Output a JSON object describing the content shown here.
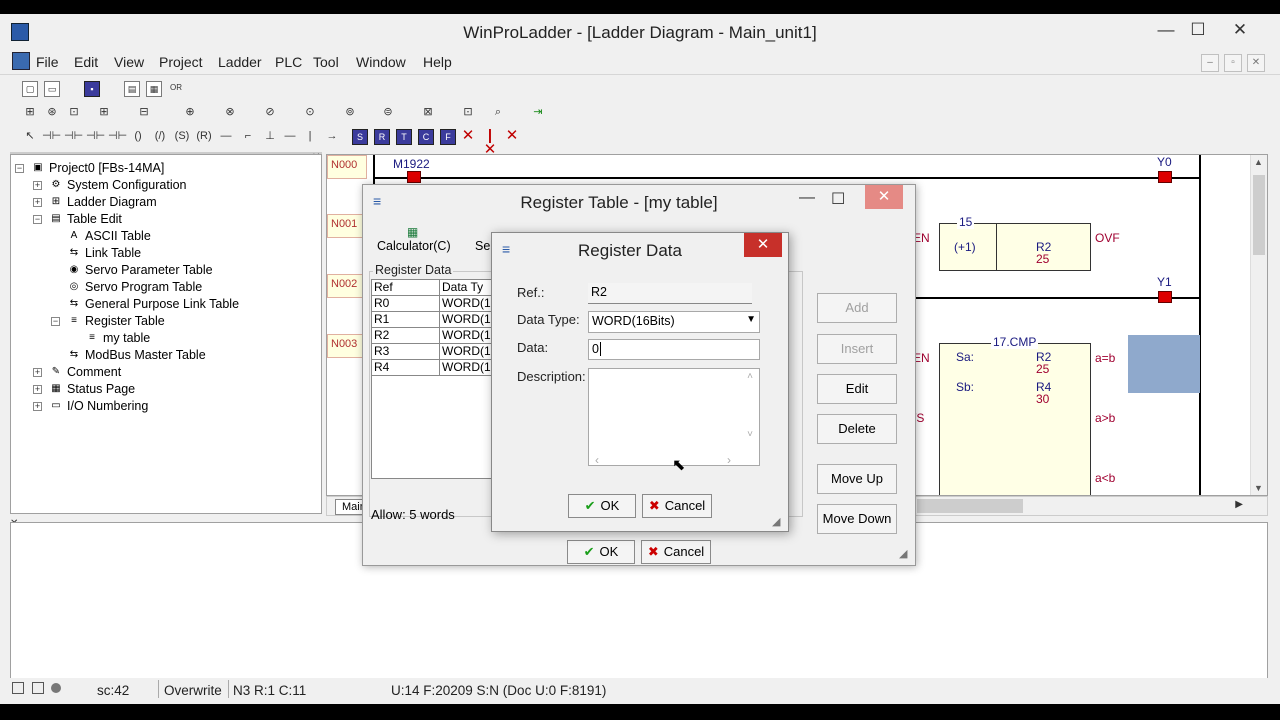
{
  "window": {
    "title": "WinProLadder - [Ladder Diagram - Main_unit1]",
    "min": "—",
    "max": "☐",
    "close": "✕"
  },
  "menu": [
    "File",
    "Edit",
    "View",
    "Project",
    "Ladder",
    "PLC",
    "Tool",
    "Window",
    "Help"
  ],
  "tree": {
    "items": [
      {
        "label": "Project0 [FBs-14MA]",
        "exp": "−",
        "icon": "▣"
      },
      {
        "label": "System Configuration",
        "exp": "+",
        "icon": "⚙"
      },
      {
        "label": "Ladder Diagram",
        "exp": "+",
        "icon": "⊞"
      },
      {
        "label": "Table Edit",
        "exp": "−",
        "icon": "▤"
      },
      {
        "label": "ASCII Table",
        "exp": "",
        "icon": "A"
      },
      {
        "label": "Link Table",
        "exp": "",
        "icon": "⇆"
      },
      {
        "label": "Servo Parameter Table",
        "exp": "",
        "icon": "◉"
      },
      {
        "label": "Servo Program Table",
        "exp": "",
        "icon": "◎"
      },
      {
        "label": "General Purpose Link Table",
        "exp": "",
        "icon": "⇆"
      },
      {
        "label": "Register Table",
        "exp": "−",
        "icon": "≡"
      },
      {
        "label": "my table",
        "exp": "",
        "icon": "≡"
      },
      {
        "label": "ModBus Master Table",
        "exp": "",
        "icon": "⇆"
      },
      {
        "label": "Comment",
        "exp": "+",
        "icon": "✎"
      },
      {
        "label": "Status Page",
        "exp": "+",
        "icon": "▦"
      },
      {
        "label": "I/O Numbering",
        "exp": "+",
        "icon": "▭"
      }
    ]
  },
  "ladder": {
    "networks": [
      "N000",
      "N001",
      "N002",
      "N003"
    ],
    "contact_m": "M1922",
    "coil_y0": "Y0",
    "coil_y1": "Y1",
    "fn15_num": "15",
    "fn15_name": "(+1)",
    "fn15_reg": "R2",
    "fn15_val": "25",
    "en": "EN",
    "ovf": "OVF",
    "fn17": "17.CMP",
    "sa": "Sa:",
    "sb": "Sb:",
    "sa_reg": "R2",
    "sa_val": "25",
    "sb_reg": "R4",
    "sb_val": "30",
    "eq": "a=b",
    "gt": "a>b",
    "lt": "a<b",
    "us": "/S",
    "tab_main": "Main"
  },
  "status": {
    "sc": "sc:42",
    "mode": "Overwrite",
    "pos": "N3 R:1 C:11",
    "info": "U:14 F:20209 S:N (Doc U:0 F:8191)"
  },
  "regtable": {
    "title": "Register Table - [my table]",
    "calc": "Calculator(C)",
    "se": "Se",
    "group": "Register Data",
    "headers": [
      "Ref",
      "Data Ty"
    ],
    "rows": [
      {
        "ref": "R0",
        "type": "WORD(1"
      },
      {
        "ref": "R1",
        "type": "WORD(1"
      },
      {
        "ref": "R2",
        "type": "WORD(1"
      },
      {
        "ref": "R3",
        "type": "WORD(1"
      },
      {
        "ref": "R4",
        "type": "WORD(1"
      }
    ],
    "allow": "Allow: 5 words",
    "buttons": {
      "add": "Add",
      "insert": "Insert",
      "edit": "Edit",
      "delete": "Delete",
      "moveup": "Move Up",
      "movedown": "Move Down"
    },
    "ok": "OK",
    "cancel": "Cancel"
  },
  "regdata": {
    "title": "Register Data",
    "ref_label": "Ref.:",
    "ref_value": "R2",
    "type_label": "Data Type:",
    "type_value": "WORD(16Bits)",
    "data_label": "Data:",
    "data_value": "0",
    "desc_label": "Description:",
    "ok": "OK",
    "cancel": "Cancel"
  }
}
